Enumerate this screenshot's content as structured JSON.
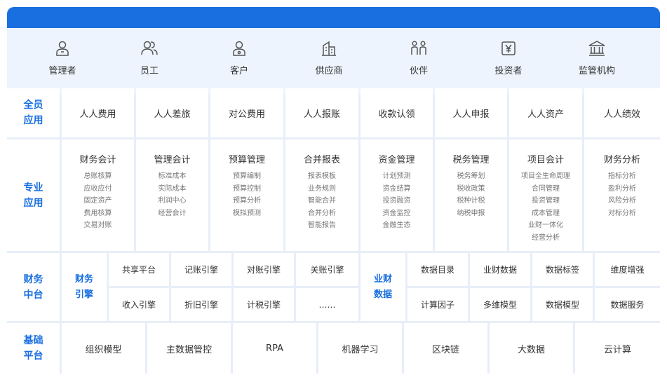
{
  "roles": [
    "管理者",
    "员工",
    "客户",
    "供应商",
    "伙伴",
    "投资者",
    "监管机构"
  ],
  "role_icons": [
    "user-icon",
    "users-icon",
    "customer-icon",
    "building-icon",
    "partners-icon",
    "investor-icon",
    "institution-icon"
  ],
  "colors": {
    "accent": "#1a6fe0",
    "background": "#e8eef8",
    "header_band": "#edf4fd"
  },
  "all_staff": {
    "label": "全员\n应用",
    "items": [
      "人人费用",
      "人人差旅",
      "对公费用",
      "人人报账",
      "收款认领",
      "人人申报",
      "人人资产",
      "人人绩效"
    ]
  },
  "professional": {
    "label": "专业\n应用",
    "modules": [
      {
        "title": "财务会计",
        "items": [
          "总账核算",
          "应收应付",
          "固定资产",
          "费用核算",
          "交易对账"
        ]
      },
      {
        "title": "管理会计",
        "items": [
          "标准成本",
          "实际成本",
          "利润中心",
          "经营会计"
        ]
      },
      {
        "title": "预算管理",
        "items": [
          "预算编制",
          "预算控制",
          "预算分析",
          "模拟预测"
        ]
      },
      {
        "title": "合并报表",
        "items": [
          "报表模板",
          "业务规则",
          "智能合并",
          "合并分析",
          "智能报告"
        ]
      },
      {
        "title": "资金管理",
        "items": [
          "计划预测",
          "资金结算",
          "投资融资",
          "资金监控",
          "金融生态"
        ]
      },
      {
        "title": "税务管理",
        "items": [
          "税务筹划",
          "税收政策",
          "税种计税",
          "纳税申报"
        ]
      },
      {
        "title": "项目会计",
        "items": [
          "项目全生命周理",
          "合同管理",
          "投资管理",
          "成本管理",
          "业财一体化",
          "经营分析"
        ]
      },
      {
        "title": "财务分析",
        "items": [
          "指标分析",
          "盈利分析",
          "风险分析",
          "对标分析"
        ]
      }
    ]
  },
  "middle": {
    "label": "财务\n中台",
    "engine_label": "财务\n引擎",
    "engines": [
      "共享平台",
      "记账引擎",
      "对账引擎",
      "关账引擎",
      "收入引擎",
      "折旧引擎",
      "计税引擎",
      "……"
    ],
    "data_label": "业财\n数据",
    "data": [
      "数据目录",
      "业财数据",
      "数据标签",
      "维度增强",
      "计算因子",
      "多维模型",
      "数据模型",
      "数据服务"
    ]
  },
  "base": {
    "label": "基础\n平台",
    "items": [
      "组织模型",
      "主数据管控",
      "RPA",
      "机器学习",
      "区块链",
      "大数据",
      "云计算"
    ]
  }
}
